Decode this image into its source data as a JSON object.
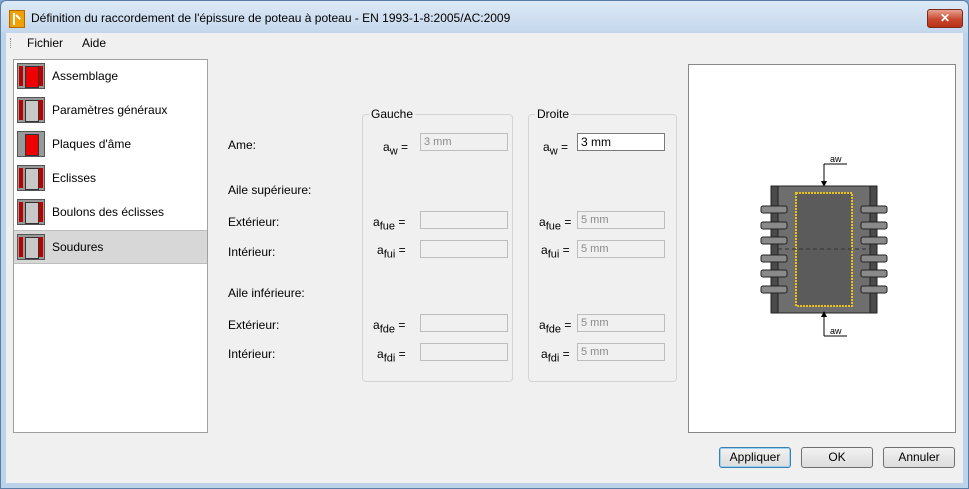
{
  "window": {
    "title": "Définition du raccordement de l'épissure de poteau à poteau - EN 1993-1-8:2005/AC:2009",
    "close_label": "✕"
  },
  "menu": {
    "file": "Fichier",
    "help": "Aide"
  },
  "nav": {
    "items": [
      {
        "label": "Assemblage",
        "icon": "assembly-icon",
        "selected": false
      },
      {
        "label": "Paramètres généraux",
        "icon": "general-parameters-icon",
        "selected": false
      },
      {
        "label": "Plaques d'âme",
        "icon": "web-plates-icon",
        "selected": false
      },
      {
        "label": "Eclisses",
        "icon": "splice-plates-icon",
        "selected": false
      },
      {
        "label": "Boulons des éclisses",
        "icon": "splice-bolts-icon",
        "selected": false
      },
      {
        "label": "Soudures",
        "icon": "welds-icon",
        "selected": true
      }
    ]
  },
  "form": {
    "left_group_title": "Gauche",
    "right_group_title": "Droite",
    "rows": {
      "web": "Ame:",
      "top_flange": "Aile supérieure:",
      "top_ext": "Extérieur:",
      "top_int": "Intérieur:",
      "bottom_flange": "Aile inférieure:",
      "bottom_ext": "Extérieur:",
      "bottom_int": "Intérieur:"
    },
    "symbols": {
      "a": "a",
      "w": "w",
      "fue": "fue",
      "fui": "fui",
      "fde": "fde",
      "fdi": "fdi",
      "eq": "="
    },
    "left": {
      "aw": "3 mm",
      "afue": "",
      "afui": "",
      "afde": "",
      "afdi": ""
    },
    "right": {
      "aw": "3 mm",
      "afue": "5 mm",
      "afui": "5 mm",
      "afde": "5 mm",
      "afdi": "5 mm"
    }
  },
  "preview": {
    "weld_label_top": "aw",
    "weld_label_bottom": "aw"
  },
  "buttons": {
    "apply": "Appliquer",
    "ok": "OK",
    "cancel": "Annuler"
  },
  "colors": {
    "weld": "#e6c21a",
    "steel_dark": "#4a4a4a",
    "steel_mid": "#6e6e6e",
    "selected_bg": "#d7d7d7"
  }
}
